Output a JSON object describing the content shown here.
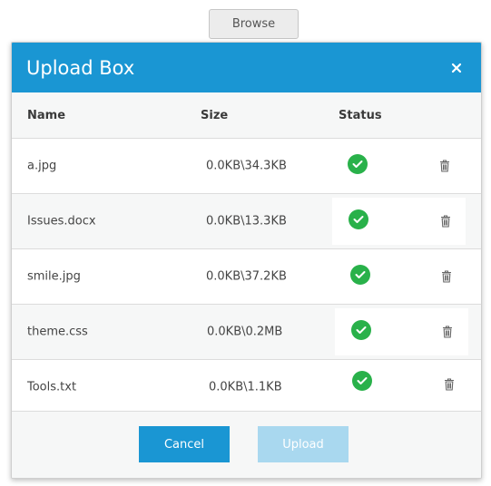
{
  "browse_label": "Browse",
  "dialog": {
    "title": "Upload Box",
    "close_icon": "close-icon"
  },
  "table": {
    "headers": {
      "name": "Name",
      "size": "Size",
      "status": "Status"
    },
    "rows": [
      {
        "name": "a.jpg",
        "size": "0.0KB\\34.3KB",
        "status": "success"
      },
      {
        "name": "Issues.docx",
        "size": "0.0KB\\13.3KB",
        "status": "success"
      },
      {
        "name": "smile.jpg",
        "size": "0.0KB\\37.2KB",
        "status": "success"
      },
      {
        "name": "theme.css",
        "size": "0.0KB\\0.2MB",
        "status": "success"
      },
      {
        "name": "Tools.txt",
        "size": "0.0KB\\1.1KB",
        "status": "success"
      }
    ]
  },
  "footer": {
    "cancel_label": "Cancel",
    "upload_label": "Upload"
  },
  "colors": {
    "accent": "#1a96d3",
    "success": "#29b14a",
    "upload_disabled": "#a9d8ef"
  }
}
